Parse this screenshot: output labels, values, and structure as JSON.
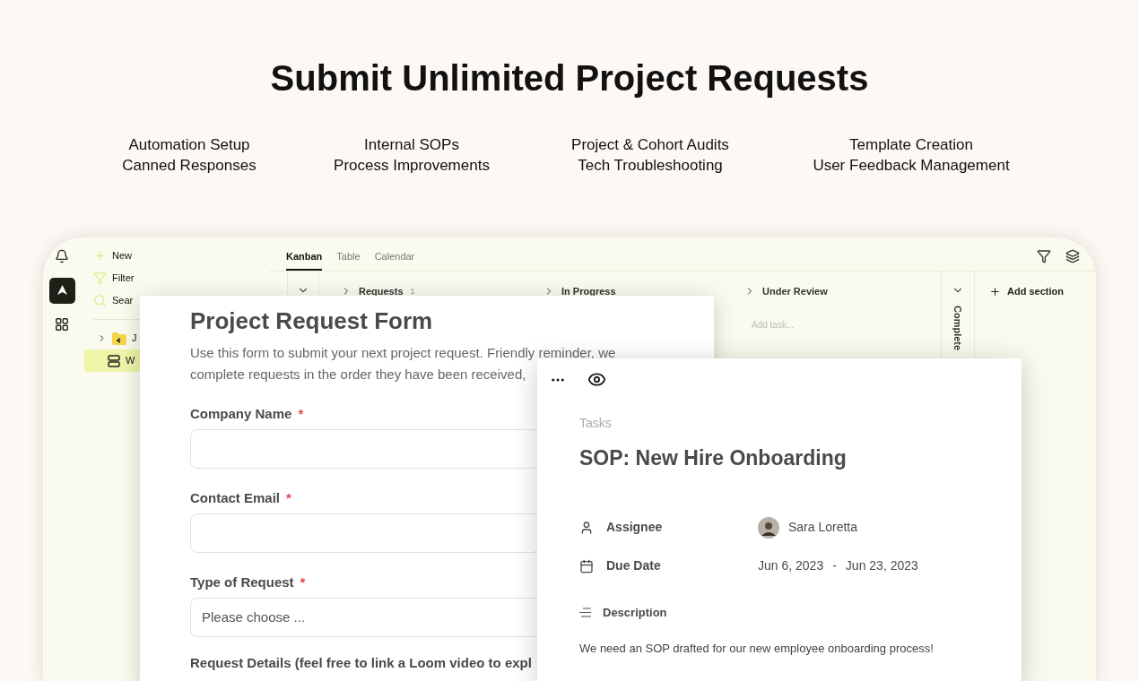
{
  "heading": "Submit Unlimited Project Requests",
  "features": [
    {
      "lines": [
        "Automation Setup",
        "Canned Responses"
      ]
    },
    {
      "lines": [
        "Internal SOPs",
        "Process Improvements"
      ]
    },
    {
      "lines": [
        "Project & Cohort Audits",
        "Tech Troubleshooting"
      ]
    },
    {
      "lines": [
        "Template Creation",
        "User Feedback Management"
      ]
    }
  ],
  "sidebar": {
    "actions": [
      {
        "kind": "new",
        "label": "New"
      },
      {
        "kind": "filter",
        "label": "Filter"
      },
      {
        "kind": "search",
        "label": "Sear"
      }
    ],
    "tree": [
      {
        "kind": "folder",
        "label": "J",
        "selected": false
      },
      {
        "kind": "board",
        "label": "W",
        "selected": true
      }
    ]
  },
  "view_tabs": [
    {
      "label": "Kanban",
      "selected": true
    },
    {
      "label": "Table",
      "selected": false
    },
    {
      "label": "Calendar",
      "selected": false
    }
  ],
  "kanban": {
    "columns": [
      {
        "title": "Requests",
        "count": "1"
      },
      {
        "title": "In Progress"
      },
      {
        "title": "Under Review",
        "add_task": "Add task..."
      }
    ],
    "collapsed_column": "Complete",
    "add_section": "Add section"
  },
  "form": {
    "title": "Project Request Form",
    "description_lines": [
      "Use this form to submit your next project request. Friendly reminder, we",
      "complete requests in the order they have been received,"
    ],
    "fields": [
      {
        "kind": "text",
        "label": "Company Name",
        "required_mark": "*"
      },
      {
        "kind": "text",
        "label": "Contact Email",
        "required_mark": "*"
      },
      {
        "kind": "select",
        "label": "Type of Request",
        "required_mark": "*",
        "placeholder": "Please choose ..."
      }
    ],
    "next_label": "Request Details (feel free to link a Loom video to expl"
  },
  "task": {
    "breadcrumb": "Tasks",
    "title": "SOP: New Hire Onboarding",
    "properties": [
      {
        "kind": "assignee",
        "label": "Assignee",
        "value": "Sara Loretta"
      },
      {
        "kind": "date",
        "label": "Due Date",
        "start": "Jun 6, 2023",
        "separator": "-",
        "end": "Jun 23, 2023"
      }
    ],
    "description_label": "Description",
    "description": "We need an SOP drafted for our new employee onboarding process!"
  }
}
